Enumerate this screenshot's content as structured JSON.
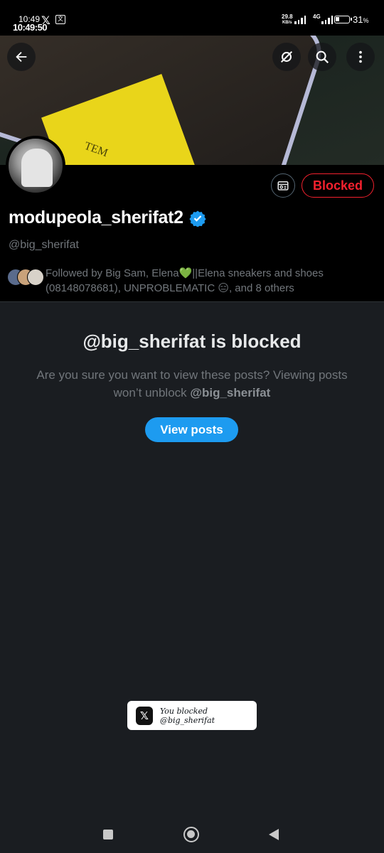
{
  "status_bar": {
    "time_small": "10:49",
    "time_main": "10:49:50",
    "net_speed_value": "29.8",
    "net_speed_unit": "KB/s",
    "network_type": "4G",
    "battery": "31",
    "battery_level": 0.31
  },
  "banner": {
    "book_text": "TEM"
  },
  "profile": {
    "display_name": "modupeola_sherifat2",
    "handle": "@big_sherifat",
    "blocked_label": "Blocked",
    "followed_by": "Followed by Big Sam, Elena💚||Elena sneakers and shoes (08148078681), UNPROBLEMATIC 😑, and 8 others"
  },
  "blocked_notice": {
    "title": "@big_sherifat is blocked",
    "description": "Are you sure you want to view these posts? Viewing posts won’t unblock",
    "description_handle": "@big_sherifat",
    "button_label": "View posts"
  },
  "toast": {
    "logo": "𝕏",
    "message": "You blocked @big_sherifat"
  },
  "colors": {
    "accent": "#1d9bf0",
    "blocked_red": "#f4212e",
    "verified": "#1d9bf0",
    "background": "#000000",
    "content_bg": "#1a1d21"
  }
}
